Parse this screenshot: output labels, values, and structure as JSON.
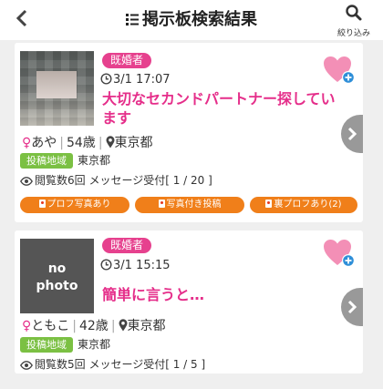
{
  "header": {
    "title": "掲示板検索結果",
    "search_label": "絞り込み"
  },
  "posts": [
    {
      "badge": "既婚者",
      "datetime": "3/1 17:07",
      "title": "大切なセカンドパートナー探しています",
      "name": "あや",
      "age": "54歳",
      "location": "東京都",
      "region_tag": "投稿地域",
      "region_value": "東京都",
      "stats": "閲覧数6回 メッセージ受付[ 1 / 20 ]",
      "chips": [
        "プロフ写真あり",
        "写真付き投稿",
        "裏プロフあり(2)"
      ]
    },
    {
      "badge": "既婚者",
      "datetime": "3/1 15:15",
      "thumb_text_1": "no",
      "thumb_text_2": "photo",
      "title": "簡単に言うと…",
      "name": "ともこ",
      "age": "42歳",
      "location": "東京都",
      "region_tag": "投稿地域",
      "region_value": "東京都",
      "stats": "閲覧数5回 メッセージ受付[ 1 / 5 ]"
    }
  ],
  "colors": {
    "accent_pink": "#e52e8a",
    "badge_pink": "#e6418e",
    "region_green": "#7bc043",
    "chip_orange": "#f07f1a"
  },
  "icons": [
    "back-chevron-icon",
    "list-icon",
    "search-icon",
    "heart-plus-icon",
    "clock-icon",
    "female-icon",
    "location-pin-icon",
    "eye-icon",
    "chevron-right-icon"
  ]
}
